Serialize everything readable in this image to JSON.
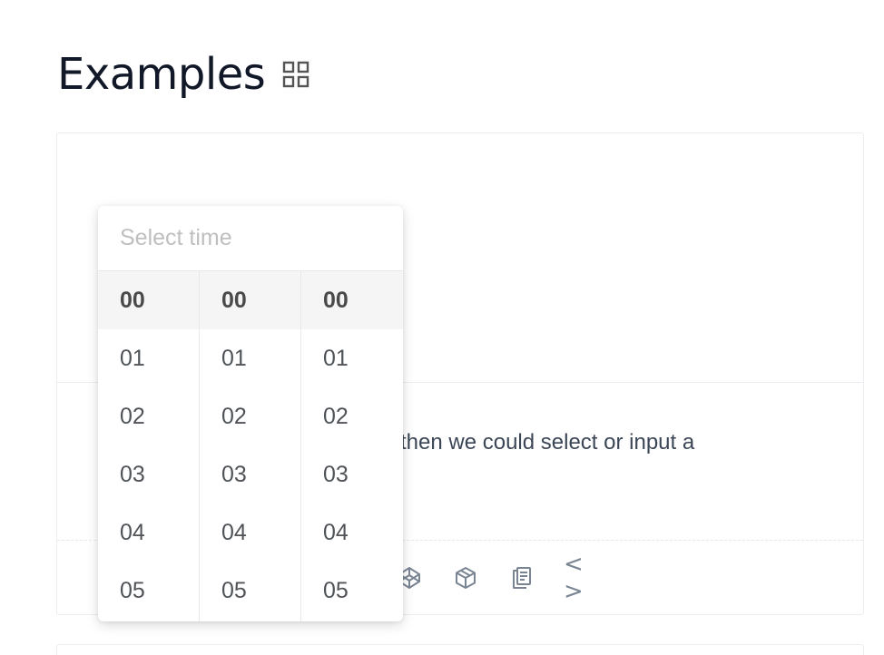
{
  "heading": {
    "title": "Examples",
    "icon": "grid-icon"
  },
  "card": {
    "description_fragment": "then we could select or input a",
    "actions": [
      "codepen-icon",
      "codesandbox-icon",
      "copy-icon",
      "code-icon"
    ],
    "code_glyph": "< >"
  },
  "time_picker": {
    "placeholder": "Select time",
    "hours": [
      "00",
      "01",
      "02",
      "03",
      "04",
      "05"
    ],
    "minutes": [
      "00",
      "01",
      "02",
      "03",
      "04",
      "05"
    ],
    "seconds": [
      "00",
      "01",
      "02",
      "03",
      "04",
      "05"
    ],
    "selected": {
      "hour": "00",
      "minute": "00",
      "second": "00"
    }
  }
}
